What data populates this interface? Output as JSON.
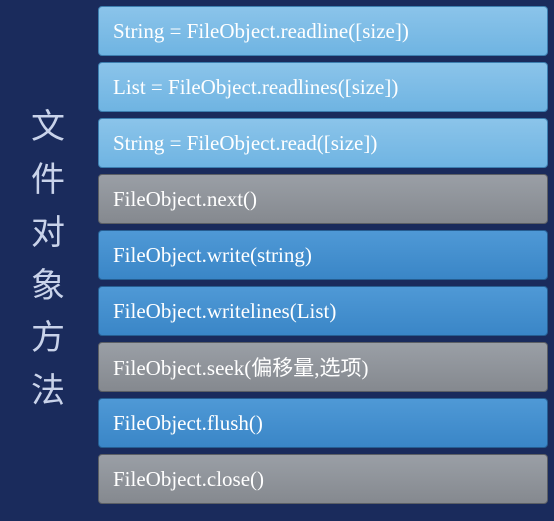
{
  "sidebar": {
    "title_chars": [
      "文",
      "件",
      "对",
      "象",
      "方",
      "法"
    ]
  },
  "rows": [
    {
      "label": "String = FileObject.readline([size])",
      "note": "",
      "variant": "blue-light"
    },
    {
      "label": "List = FileObject.readlines([size])",
      "note": "",
      "variant": "blue-light"
    },
    {
      "label": "String = FileObject.read([size])",
      "note": "",
      "variant": "blue-light"
    },
    {
      "label": "FileObject.next()",
      "note": "",
      "variant": "gray"
    },
    {
      "label": "FileObject.write(string)",
      "note": "",
      "variant": "blue-deep"
    },
    {
      "label": "FileObject.writelines(List)",
      "note": "",
      "variant": "blue-deep"
    },
    {
      "label": "FileObject.seek(偏移量,选项)",
      "note": "",
      "variant": "gray"
    },
    {
      "label": "FileObject.flush()",
      "note": "",
      "variant": "blue-deep"
    },
    {
      "label": "FileObject.close()",
      "note": "",
      "variant": "gray"
    }
  ]
}
